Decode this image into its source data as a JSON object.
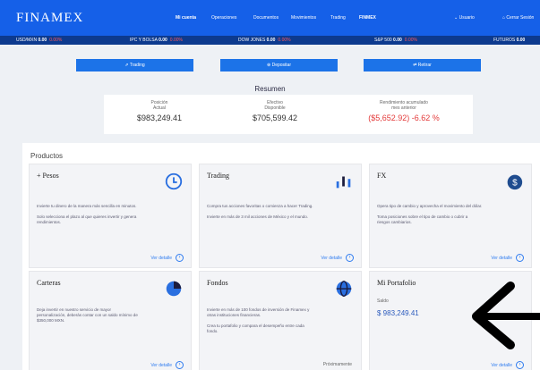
{
  "header": {
    "logo": "FINAMEX",
    "nav": [
      "Mi cuenta",
      "Operaciones",
      "Documentos",
      "Movimientos",
      "Trading",
      "FINMEX"
    ],
    "user_label": "Usuario",
    "user_action": "Cerrar Sesión"
  },
  "ticker": [
    {
      "label": "USD/MXN",
      "value": "0.00",
      "change": "0.00%"
    },
    {
      "label": "IPC Y BOLSA",
      "value": "0.00",
      "change": "0.00%"
    },
    {
      "label": "DOW JONES",
      "value": "0.00",
      "change": "0.00%"
    },
    {
      "label": "S&P 500",
      "value": "0.00",
      "change": "0.00%"
    },
    {
      "label": "FUTUROS",
      "value": "0.00",
      "change": ""
    }
  ],
  "actions": [
    {
      "label": "Trading",
      "icon": "chart-icon"
    },
    {
      "label": "Depositar",
      "icon": "plus-icon"
    },
    {
      "label": "Retirar",
      "icon": "transfer-icon"
    }
  ],
  "resumen": {
    "title": "Resumen",
    "items": [
      {
        "label_line1": "Posición",
        "label_line2": "Actual",
        "value": "$983,249.41",
        "negative": false
      },
      {
        "label_line1": "Efectivo",
        "label_line2": "Disponible",
        "value": "$705,599.42",
        "negative": false
      },
      {
        "label_line1": "Rendimiento acumulado",
        "label_line2": "mes anterior",
        "value": "($5,652.92) -6.62 %",
        "negative": true
      }
    ]
  },
  "products": {
    "title": "Productos",
    "cards": [
      {
        "title": "+ Pesos",
        "icon": "clock-icon",
        "desc_lines": [
          "Invierte tu dinero de la manera más sencilla en minutos.",
          "",
          "Solo selecciona el plazo al que quieres invertir y genera",
          "rendimientos."
        ],
        "link": "Ver detalle"
      },
      {
        "title": "Trading",
        "icon": "bar-chart-icon",
        "desc_lines": [
          "Compra tus acciones favoritas o comienza a hacer Trading.",
          "",
          "Invierte en más de 3 mil acciones de México y el mundo."
        ],
        "link": "Ver detalle"
      },
      {
        "title": "FX",
        "icon": "dollar-exchange-icon",
        "desc_lines": [
          "Opera tipo de cambio y aprovecha el movimiento del dólar.",
          "",
          "Toma posiciones sobre el tipo de cambio o cubrir a",
          "riesgos cambiarios."
        ],
        "link": "Ver detalle"
      },
      {
        "title": "Carteras",
        "icon": "pie-chart-icon",
        "desc_lines": [
          "Deja invertir en nuestro servicio de mayor",
          "personalización, deberás contar con un saldo mínimo de",
          "$350,000 MXN."
        ],
        "link": "Ver detalle"
      },
      {
        "title": "Fondos",
        "icon": "globe-icon",
        "desc_lines": [
          "Invierte en más de 100 fondos de inversión de Finamex y",
          "otras instituciones financieras.",
          "",
          "Crea tu portafolio y compara el desempeño entre cada",
          "fondo."
        ],
        "link": "Próximamente"
      },
      {
        "title": "Mi Portafolio",
        "icon": "",
        "balance_label": "Saldo",
        "balance_value": "$ 983,249.41",
        "link": "Ver detalle"
      }
    ]
  }
}
